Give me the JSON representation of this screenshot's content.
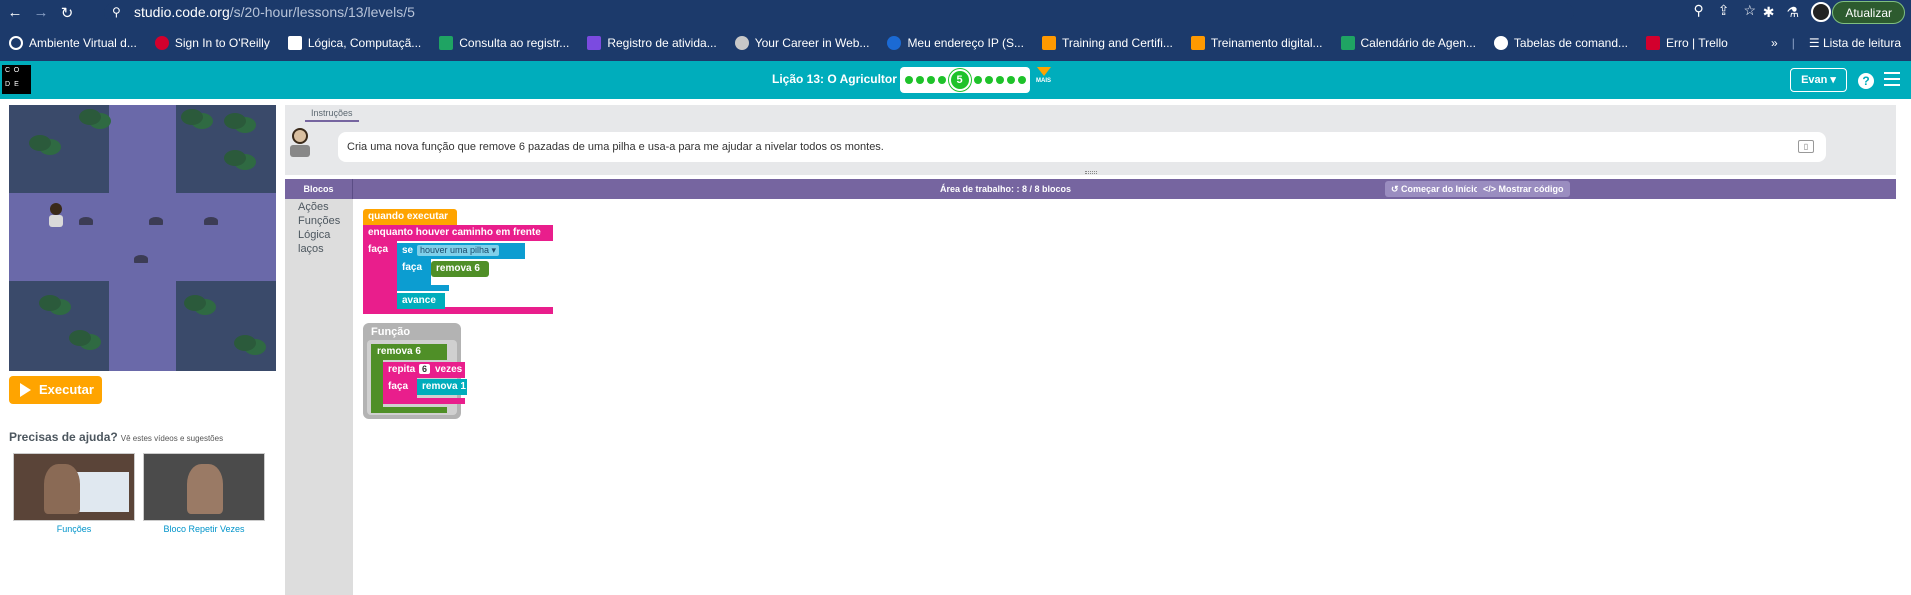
{
  "browser": {
    "url_host": "studio.code.org",
    "url_path": "/s/20-hour/lessons/13/levels/5",
    "update_label": "Atualizar",
    "bookmarks": [
      {
        "label": "Ambiente Virtual d...",
        "color": "#ffffff"
      },
      {
        "label": "Sign In to O'Reilly",
        "color": "#d3002d"
      },
      {
        "label": "Lógica, Computaçã...",
        "color": "#ffffff"
      },
      {
        "label": "Consulta ao registr...",
        "color": "#1fa463"
      },
      {
        "label": "Registro de ativida...",
        "color": "#7b4be0"
      },
      {
        "label": "Your Career in Web...",
        "color": "#c8c8c8"
      },
      {
        "label": "Meu endereço IP (S...",
        "color": "#1b6ad4"
      },
      {
        "label": "Training and Certifi...",
        "color": "#ff9900"
      },
      {
        "label": "Treinamento digital...",
        "color": "#ff9900"
      },
      {
        "label": "Calendário de Agen...",
        "color": "#1fa463"
      },
      {
        "label": "Tabelas de comand...",
        "color": "#ffffff"
      },
      {
        "label": "Erro | Trello",
        "color": "#d3002d"
      }
    ],
    "more_bookmarks": "»",
    "reading_list": "Lista de leitura"
  },
  "header": {
    "logo_letters": [
      "C",
      "O",
      "D",
      "E"
    ],
    "lesson_title": "Lição 13: O Agricultor 2",
    "current_level": "5",
    "more_label": "MAIS",
    "user_label": "Evan",
    "help_label": "?"
  },
  "left": {
    "run_label": "Executar",
    "help_title": "Precisas de ajuda?",
    "help_sub": "Vê estes vídeos e sugestões",
    "videos": [
      {
        "label": "Funções"
      },
      {
        "label": "Bloco Repetir Vezes"
      }
    ]
  },
  "instructions": {
    "tab": "Instruções",
    "text": "Cria uma nova função que remove 6 pazadas de uma pilha e usa-a para me ajudar a nivelar todos os montes."
  },
  "workspace": {
    "toolbox_title": "Blocos",
    "title": "Área de trabalho: : 8 / 8 blocos",
    "reset_label": "Começar do Início",
    "show_code_label": "Mostrar código",
    "toolbox_items": [
      "Ações",
      "Funções",
      "Lógica",
      "laços"
    ]
  },
  "blocks": {
    "when_run": "quando executar",
    "while_path": "enquanto houver caminho em frente",
    "do": "faça",
    "if": "se",
    "pile_field": "houver uma pilha ▾",
    "do2": "faça",
    "remove6": "remova 6",
    "move": "avance",
    "function_label": "Função",
    "fn_name": "remova 6",
    "repeat": "repita",
    "repeat_count": "6",
    "times": "vezes",
    "do3": "faça",
    "remove1": "remova 1"
  },
  "colors": {
    "header": "#00adbc",
    "run": "#ffa400",
    "workspace_bar": "#7665a0"
  }
}
